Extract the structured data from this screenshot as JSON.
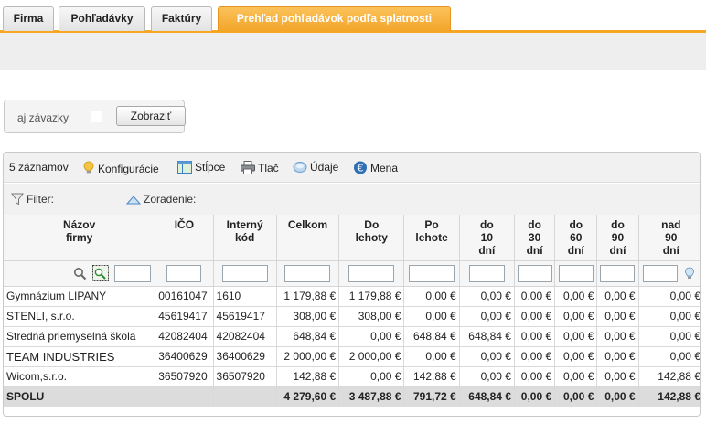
{
  "tabs": [
    {
      "label": "Firma",
      "active": false
    },
    {
      "label": "Pohľadávky",
      "active": false
    },
    {
      "label": "Faktúry",
      "active": false
    },
    {
      "label": "Prehľad pohľadávok podľa splatnosti",
      "active": true
    }
  ],
  "options": {
    "label": "aj závazky",
    "checked": false,
    "button": "Zobraziť"
  },
  "toolbar": {
    "count": "5 záznamov",
    "configuration": "Konfigurácie",
    "columns": "Stĺpce",
    "print": "Tlač",
    "data": "Údaje",
    "currency": "Mena"
  },
  "filterbar": {
    "filter": "Filter:",
    "sort": "Zoradenie:"
  },
  "columns": [
    "Názov\nfirmy",
    "IČO",
    "Interný\nkód",
    "Celkom",
    "Do\nlehoty",
    "Po\nlehote",
    "do\n10\ndní",
    "do\n30\ndní",
    "do\n60\ndní",
    "do\n90\ndní",
    "nad\n90\ndní"
  ],
  "rows": [
    [
      "Gymnázium LIPANY",
      "00161047",
      "1610",
      "1 179,88 €",
      "1 179,88 €",
      "0,00 €",
      "0,00 €",
      "0,00 €",
      "0,00 €",
      "0,00 €",
      "0,00 €"
    ],
    [
      "STENLI, s.r.o.",
      "45619417",
      "45619417",
      "308,00 €",
      "308,00 €",
      "0,00 €",
      "0,00 €",
      "0,00 €",
      "0,00 €",
      "0,00 €",
      "0,00 €"
    ],
    [
      "Stredná priemyselná škola",
      "42082404",
      "42082404",
      "648,84 €",
      "0,00 €",
      "648,84 €",
      "648,84 €",
      "0,00 €",
      "0,00 €",
      "0,00 €",
      "0,00 €"
    ],
    [
      "TEAM INDUSTRIES",
      "36400629",
      "36400629",
      "2 000,00 €",
      "2 000,00 €",
      "0,00 €",
      "0,00 €",
      "0,00 €",
      "0,00 €",
      "0,00 €",
      "0,00 €"
    ],
    [
      "Wicom,s.r.o.",
      "36507920",
      "36507920",
      "142,88 €",
      "0,00 €",
      "142,88 €",
      "0,00 €",
      "0,00 €",
      "0,00 €",
      "0,00 €",
      "142,88 €"
    ]
  ],
  "total": [
    "SPOLU",
    "",
    "",
    "4 279,60 €",
    "3 487,88 €",
    "791,72 €",
    "648,84 €",
    "0,00 €",
    "0,00 €",
    "0,00 €",
    "142,88 €"
  ],
  "colors": {
    "accent": "#f5a623",
    "tab_active": "#f3a52a"
  }
}
